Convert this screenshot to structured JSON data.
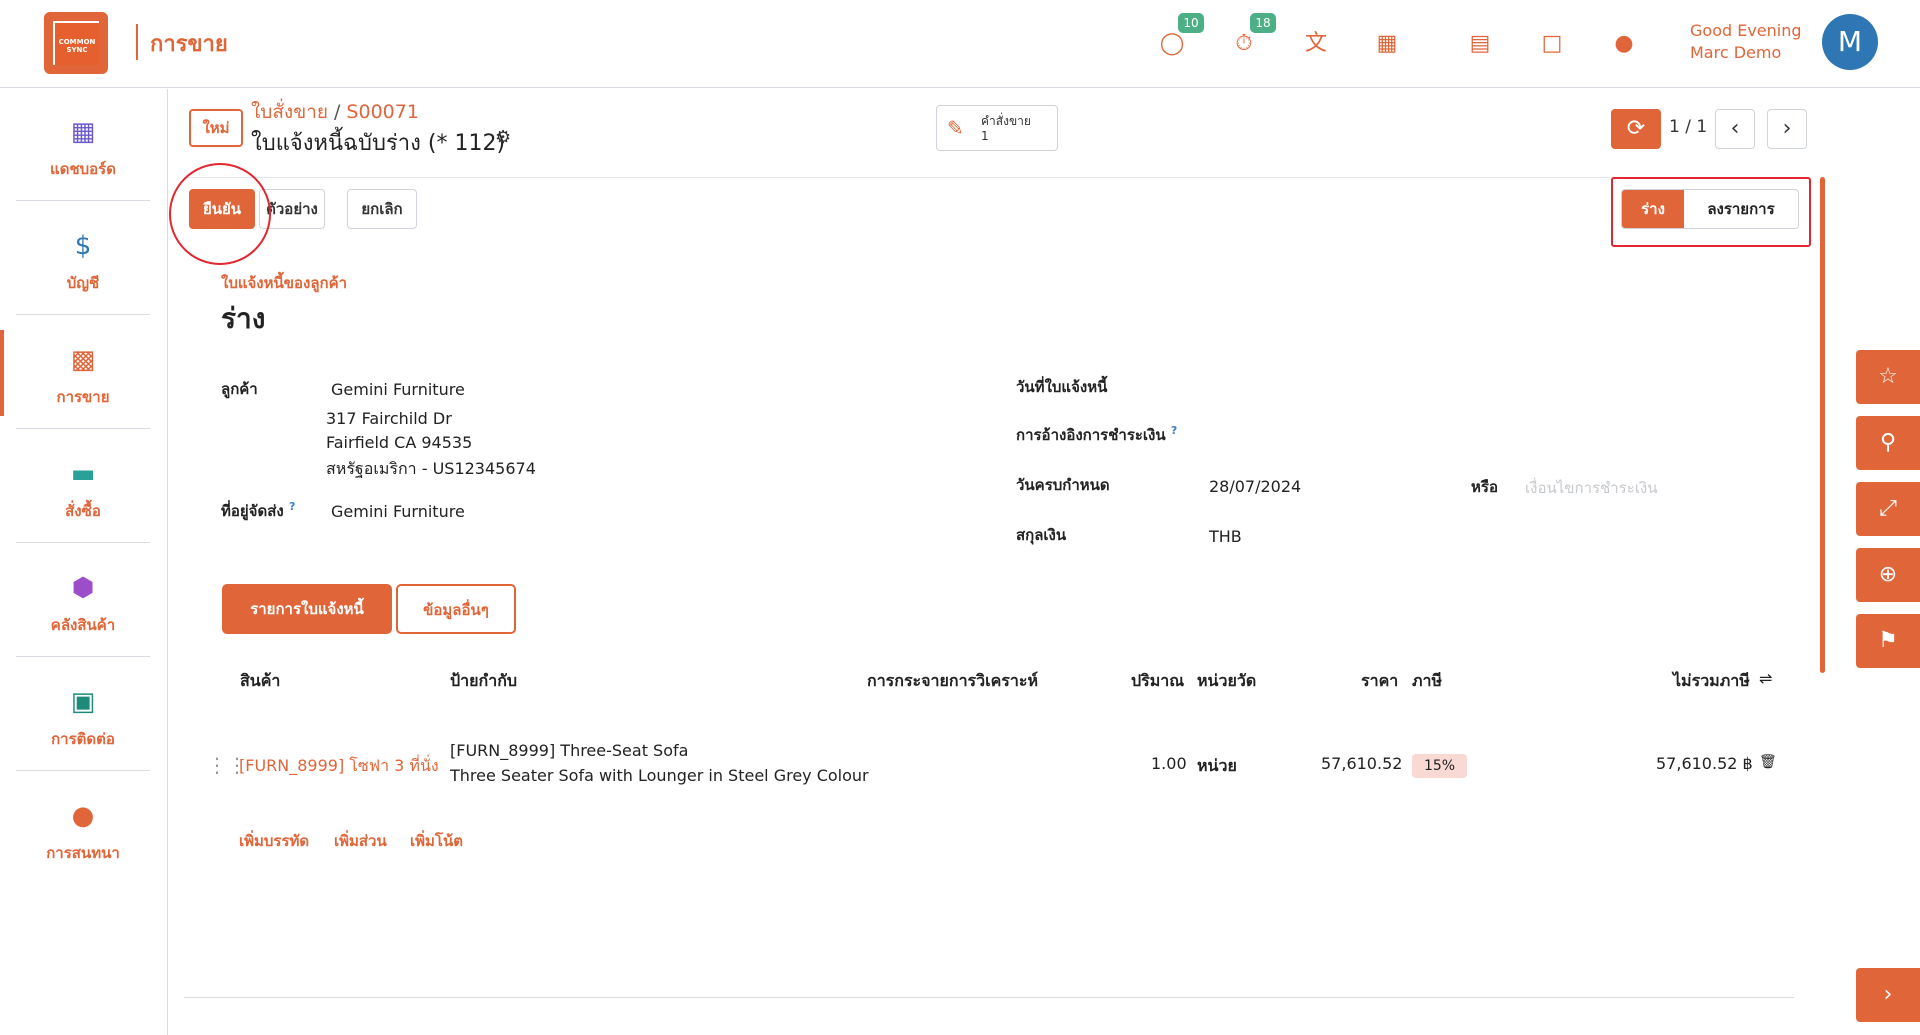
{
  "header": {
    "logo_text": "COMMON SYNC",
    "app_title": "การขาย",
    "chat_badge": "10",
    "timer_badge": "18",
    "greeting": "Good Evening",
    "user_name": "Marc Demo",
    "avatar_letter": "M"
  },
  "sidebar": {
    "items": [
      {
        "label": "แดชบอร์ด",
        "icon": "dashboard-icon"
      },
      {
        "label": "บัญชี",
        "icon": "accounting-icon"
      },
      {
        "label": "การขาย",
        "icon": "sales-icon"
      },
      {
        "label": "สั่งซื้อ",
        "icon": "purchase-icon"
      },
      {
        "label": "คลังสินค้า",
        "icon": "inventory-icon"
      },
      {
        "label": "การติดต่อ",
        "icon": "contacts-icon"
      },
      {
        "label": "การสนทนา",
        "icon": "discuss-icon"
      }
    ]
  },
  "control": {
    "new_label": "ใหม่",
    "breadcrumb_parent": "ใบสั่งขาย",
    "breadcrumb_sep": "/",
    "breadcrumb_current": "S00071",
    "record_title": "ใบแจ้งหนี้ฉบับร่าง (* 112)",
    "smart_button_label": "คำสั่งขาย",
    "smart_button_count": "1",
    "pager": "1 / 1"
  },
  "actions": {
    "confirm": "ยืนยัน",
    "preview": "ตัวอย่าง",
    "cancel": "ยกเลิก"
  },
  "status": {
    "draft": "ร่าง",
    "posted": "ลงรายการ"
  },
  "form": {
    "doc_type": "ใบแจ้งหนี้ของลูกค้า",
    "state": "ร่าง",
    "customer_label": "ลูกค้า",
    "customer_name": "Gemini Furniture",
    "address_line1": "317 Fairchild Dr",
    "address_line2": "Fairfield CA 94535",
    "address_line3": "สหรัฐอเมริกา - US12345674",
    "delivery_label": "ที่อยู่จัดส่ง",
    "delivery_value": "Gemini Furniture",
    "invoice_date_label": "วันที่ใบแจ้งหนี้",
    "payment_ref_label": "การอ้างอิงการชำระเงิน",
    "due_date_label": "วันครบกำหนด",
    "due_date_value": "28/07/2024",
    "or_label": "หรือ",
    "payment_terms_placeholder": "เงื่อนไขการชำระเงิน",
    "currency_label": "สกุลเงิน",
    "currency_value": "THB",
    "help_mark": "?"
  },
  "tabs": {
    "lines": "รายการใบแจ้งหนี้",
    "other": "ข้อมูลอื่นๆ"
  },
  "table": {
    "headers": {
      "product": "สินค้า",
      "label": "ป้ายกำกับ",
      "analytic": "การกระจายการวิเคราะห์",
      "quantity": "ปริมาณ",
      "uom": "หน่วยวัด",
      "price": "ราคา",
      "taxes": "ภาษี",
      "subtotal": "ไม่รวมภาษี"
    },
    "rows": [
      {
        "product": "[FURN_8999] โซฟา 3 ที่นั่ง",
        "label_line1": "[FURN_8999] Three-Seat Sofa",
        "label_line2": "Three Seater Sofa with Lounger in Steel Grey Colour",
        "quantity": "1.00",
        "uom": "หน่วย",
        "price": "57,610.52",
        "tax": "15%",
        "subtotal": "57,610.52 ฿"
      }
    ],
    "add_line": "เพิ่มบรรทัด",
    "add_section": "เพิ่มส่วน",
    "add_note": "เพิ่มโน้ต"
  },
  "colors": {
    "accent": "#e0663a",
    "annotation": "#e3262f",
    "badge": "#4caf85",
    "avatar": "#2f76b5"
  }
}
